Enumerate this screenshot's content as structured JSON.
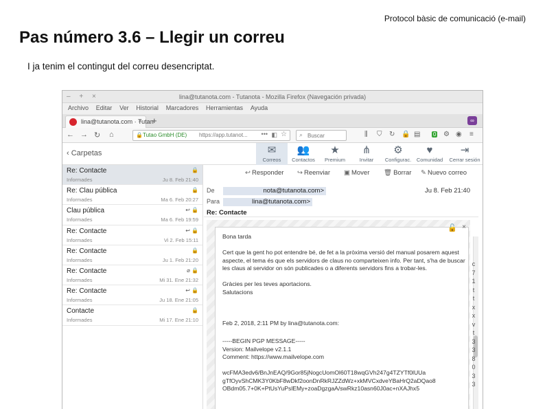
{
  "slide": {
    "header_right": "Protocol bàsic de comunicació (e-mail)",
    "title": "Pas número 3.6 – Llegir un correu",
    "subtitle": "I ja tenim el contingut del correu desencriptat."
  },
  "browser": {
    "window_buttons": "– + ×",
    "window_title": "lina@tutanota.com - Tutanota - Mozilla Firefox (Navegación privada)",
    "menu": [
      "Archivo",
      "Editar",
      "Ver",
      "Historial",
      "Marcadores",
      "Herramientas",
      "Ayuda"
    ],
    "tab_label": "lina@tutanota.com · Tutan",
    "tab_close": "×",
    "new_tab": "+",
    "private_badge": "∞",
    "nav_buttons": {
      "back": "←",
      "forward": "→",
      "reload": "↻",
      "home": "⌂"
    },
    "url_identity": "Tutao GmbH (DE)",
    "url": "https://app.tutanot...",
    "url_dots": "•••",
    "search_placeholder": "Buscar",
    "addon_badge": "0"
  },
  "tutanota": {
    "back_label": "Carpetas",
    "nav": [
      {
        "label": "Correos",
        "icon": "envelope-icon",
        "glyph": "✉"
      },
      {
        "label": "Contactos",
        "icon": "contacts-icon",
        "glyph": "👥"
      },
      {
        "label": "Premium",
        "icon": "star-icon",
        "glyph": "★"
      },
      {
        "label": "Invitar",
        "icon": "share-icon",
        "glyph": "⋔"
      },
      {
        "label": "Configurac.",
        "icon": "gear-icon",
        "glyph": "⚙"
      },
      {
        "label": "Comunidad",
        "icon": "heart-icon",
        "glyph": "♥"
      },
      {
        "label": "Cerrar sesión",
        "icon": "logout-icon",
        "glyph": "⇥"
      }
    ],
    "actions": [
      {
        "label": "Responder",
        "icon": "reply-icon",
        "glyph": "↩"
      },
      {
        "label": "Reenviar",
        "icon": "forward-icon",
        "glyph": "↪"
      },
      {
        "label": "Mover",
        "icon": "move-icon",
        "glyph": "▣"
      },
      {
        "label": "Borrar",
        "icon": "trash-icon",
        "glyph": "🗑"
      },
      {
        "label": "Nuevo correo",
        "icon": "compose-icon",
        "glyph": "✎"
      }
    ],
    "mails": [
      {
        "subject": "Re: Contacte",
        "folder": "Informades",
        "date": "Ju 8. Feb 21:40",
        "selected": true
      },
      {
        "subject": "Re: Clau pública",
        "folder": "Informades",
        "date": "Ma 6. Feb 20:27",
        "selected": false
      },
      {
        "subject": "Clau pública",
        "folder": "Informades",
        "date": "Ma 6. Feb 19:59",
        "selected": false,
        "replied": true
      },
      {
        "subject": "Re: Contacte",
        "folder": "Informades",
        "date": "Vi 2. Feb 15:11",
        "selected": false,
        "replied": true
      },
      {
        "subject": "Re: Contacte",
        "folder": "Informades",
        "date": "Ju 1. Feb 21:20",
        "selected": false
      },
      {
        "subject": "Re: Contacte",
        "folder": "Informades",
        "date": "Mi 31. Ene 21:32",
        "selected": false,
        "attachment": true
      },
      {
        "subject": "Re: Contacte",
        "folder": "Informades",
        "date": "Ju 18. Ene 21:05",
        "selected": false,
        "replied": true
      },
      {
        "subject": "Contacte",
        "folder": "Informades",
        "date": "Mi 17. Ene 21:10",
        "selected": false
      }
    ],
    "reader": {
      "from_label": "De",
      "from": "nota@tutanota.com>",
      "to_label": "Para",
      "to": "lina@tutanota.com>",
      "date": "Ju 8. Feb 21:40",
      "subject": "Re: Contacte",
      "body_lines": [
        "Bona tarda",
        "",
        "Cert que la gent ho pot entendre bé, de fet a la pròxima versió del manual posarem aquest",
        "aspecte, el tema és que els servidors de claus no comparteixen info. Per tant, s'ha de buscar",
        "les claus al servidor on són publicades o a diferents servidors fins a trobar-les.",
        "",
        "Gràcies per les teves aportacions.",
        "Salutacions",
        "",
        "",
        "Feb 2, 2018, 2:11 PM by        lina@tutanota.com:",
        "",
        "-----BEGIN PGP MESSAGE-----",
        "Version: Mailvelope v2.1.1",
        "Comment: https://www.mailvelope.com",
        "",
        "wcFMA3edv6/BnJnEAQ/9Gor85jNogcUomOl60T18wqGVh247g4TZYTf0lUUa",
        "gTfOyvShCMK3Y0KbF8wDkf2oonDnRkRJZZdWz+xkMVCxdveYBaHrQ2aDQao8",
        "OBdm05.7+0K+PtUsYuPslEMy+zoaDgzgaA/swRkz10asn60J0ac+nXAJhx5"
      ]
    },
    "edge_chars": [
      "c",
      "7",
      "1",
      "t",
      "t",
      "x",
      "x",
      "v",
      "t",
      "3",
      "3",
      "8",
      "0",
      "3",
      "3"
    ]
  }
}
